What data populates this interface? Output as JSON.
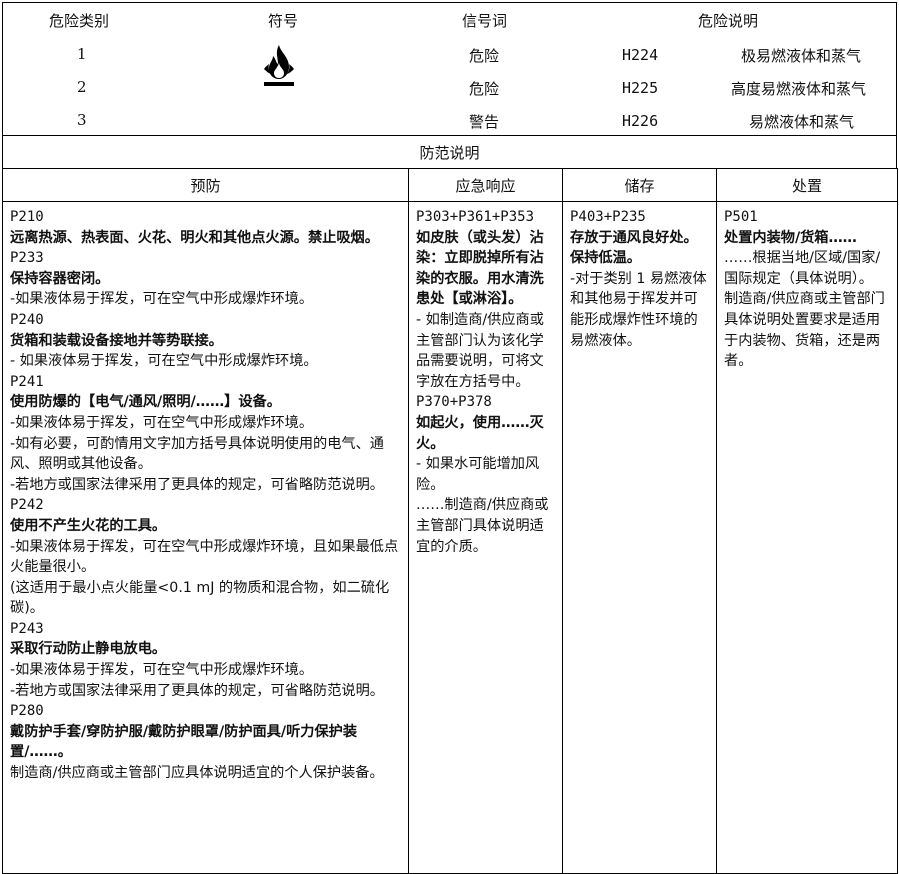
{
  "hazard_header": {
    "category": "危险类别",
    "symbol": "符号",
    "signal": "信号词",
    "statement": "危险说明"
  },
  "hazards": [
    {
      "category": "1",
      "signal": "危险",
      "code": "H224",
      "text": "极易燃液体和蒸气"
    },
    {
      "category": "2",
      "signal": "危险",
      "code": "H225",
      "text": "高度易燃液体和蒸气"
    },
    {
      "category": "3",
      "signal": "警告",
      "code": "H226",
      "text": "易燃液体和蒸气"
    }
  ],
  "precaution_title": "防范说明",
  "columns": {
    "prevention": "预防",
    "response": "应急响应",
    "storage": "储存",
    "disposal": "处置"
  },
  "prevention": [
    {
      "code": "P210",
      "title": "远离热源、热表面、火花、明火和其他点火源。禁止吸烟。",
      "notes": []
    },
    {
      "code": "P233",
      "title": "保持容器密闭。",
      "notes": [
        "-如果液体易于挥发，可在空气中形成爆炸环境。"
      ]
    },
    {
      "code": "P240",
      "title": "货箱和装载设备接地并等势联接。",
      "notes": [
        "- 如果液体易于挥发，可在空气中形成爆炸环境。"
      ]
    },
    {
      "code": "P241",
      "title": "使用防爆的【电气/通风/照明/……】设备。",
      "notes": [
        "-如果液体易于挥发，可在空气中形成爆炸环境。",
        "-如有必要，可酌情用文字加方括号具体说明使用的电气、通风、照明或其他设备。",
        "-若地方或国家法律采用了更具体的规定，可省略防范说明。"
      ]
    },
    {
      "code": "P242",
      "title": "使用不产生火花的工具。",
      "notes": [
        "-如果液体易于挥发，可在空气中形成爆炸环境，且如果最低点火能量很小。",
        "(这适用于最小点火能量<0.1 mJ 的物质和混合物，如二硫化碳)。"
      ]
    },
    {
      "code": "P243",
      "title": "采取行动防止静电放电。",
      "notes": [
        "-如果液体易于挥发，可在空气中形成爆炸环境。",
        "-若地方或国家法律采用了更具体的规定，可省略防范说明。"
      ]
    },
    {
      "code": "P280",
      "title": "戴防护手套/穿防护服/戴防护眼罩/防护面具/听力保护装置/……。",
      "notes": [
        "制造商/供应商或主管部门应具体说明适宜的个人保护装备。"
      ]
    }
  ],
  "response": [
    {
      "code": "P303+P361+P353",
      "title": "如皮肤（或头发）沾染：立即脱掉所有沾染的衣服。用水清洗患处【或淋浴】。",
      "notes": [
        "- 如制造商/供应商或主管部门认为该化学品需要说明，可将文字放在方括号中。"
      ]
    },
    {
      "code": "P370+P378",
      "title": "如起火，使用……灭火。",
      "notes": [
        "- 如果水可能增加风险。",
        "……制造商/供应商或主管部门具体说明适宜的介质。"
      ]
    }
  ],
  "storage": [
    {
      "code": "P403+P235",
      "title": "存放于通风良好处。保持低温。",
      "notes": [
        "-对于类别 1 易燃液体和其他易于挥发并可能形成爆炸性环境的易燃液体。"
      ]
    }
  ],
  "disposal": [
    {
      "code": "P501",
      "title": "处置内装物/货箱……",
      "notes": [
        "……根据当地/区域/国家/国际规定（具体说明）。",
        "制造商/供应商或主管部门具体说明处置要求是适用于内装物、货箱，还是两者。"
      ]
    }
  ],
  "icons": {
    "symbol": "flame-icon",
    "color": "#000000"
  }
}
